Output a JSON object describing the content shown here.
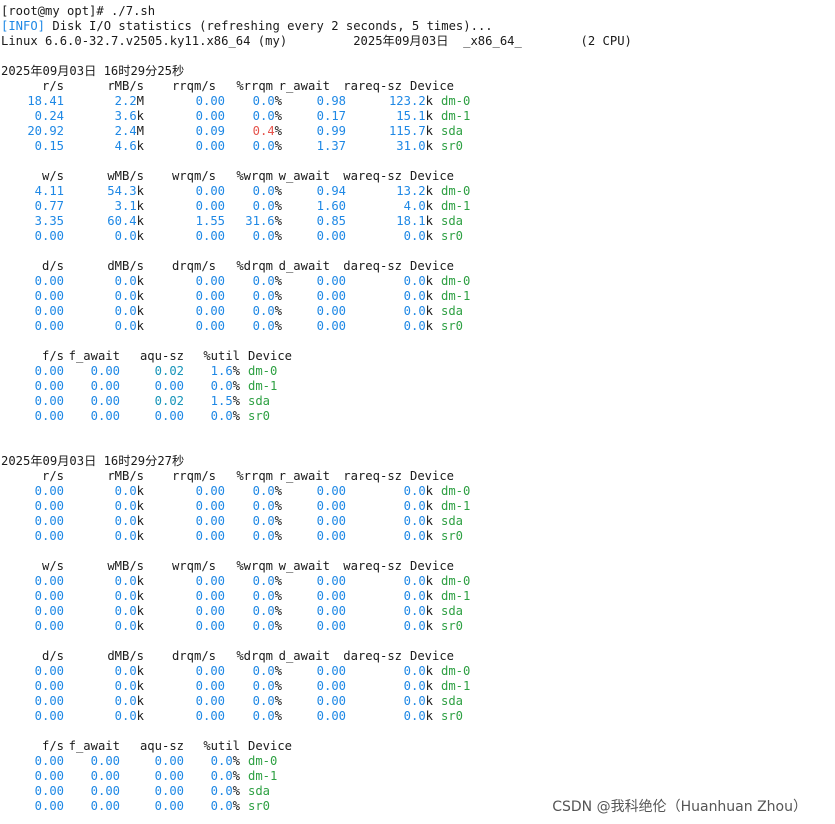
{
  "header": {
    "prompt": "[root@my opt]# ./7.sh",
    "info_tag": "[INFO]",
    "info_text": " Disk I/O statistics (refreshing every 2 seconds, 5 times)...",
    "system": "Linux 6.6.0-32.7.v2505.ky11.x86_64 (my)         2025年09月03日  _x86_64_        (2 CPU)"
  },
  "colors": {
    "value": "#1e88e5",
    "device": "#2ea043",
    "highlight": "#e5534b"
  },
  "snapshots": [
    {
      "timestamp": "2025年09月03日 16时29分25秒",
      "read": {
        "headers": [
          "r/s",
          "rMB/s",
          "rrqm/s",
          "%rrqm",
          "r_await",
          "rareq-sz",
          "Device"
        ],
        "rows": [
          [
            "18.41",
            "2.2",
            "M",
            "0.00",
            "0.0",
            "%",
            "0.98",
            "123.2",
            "k",
            "dm-0"
          ],
          [
            "0.24",
            "3.6",
            "k",
            "0.00",
            "0.0",
            "%",
            "0.17",
            "15.1",
            "k",
            "dm-1"
          ],
          [
            "20.92",
            "2.4",
            "M",
            "0.09",
            "0.4",
            "%",
            "0.99",
            "115.7",
            "k",
            "sda"
          ],
          [
            "0.15",
            "4.6",
            "k",
            "0.00",
            "0.0",
            "%",
            "1.37",
            "31.0",
            "k",
            "sr0"
          ]
        ]
      },
      "write": {
        "headers": [
          "w/s",
          "wMB/s",
          "wrqm/s",
          "%wrqm",
          "w_await",
          "wareq-sz",
          "Device"
        ],
        "rows": [
          [
            "4.11",
            "54.3",
            "k",
            "0.00",
            "0.0",
            "%",
            "0.94",
            "13.2",
            "k",
            "dm-0"
          ],
          [
            "0.77",
            "3.1",
            "k",
            "0.00",
            "0.0",
            "%",
            "1.60",
            "4.0",
            "k",
            "dm-1"
          ],
          [
            "3.35",
            "60.4",
            "k",
            "1.55",
            "31.6",
            "%",
            "0.85",
            "18.1",
            "k",
            "sda"
          ],
          [
            "0.00",
            "0.0",
            "k",
            "0.00",
            "0.0",
            "%",
            "0.00",
            "0.0",
            "k",
            "sr0"
          ]
        ]
      },
      "discard": {
        "headers": [
          "d/s",
          "dMB/s",
          "drqm/s",
          "%drqm",
          "d_await",
          "dareq-sz",
          "Device"
        ],
        "rows": [
          [
            "0.00",
            "0.0",
            "k",
            "0.00",
            "0.0",
            "%",
            "0.00",
            "0.0",
            "k",
            "dm-0"
          ],
          [
            "0.00",
            "0.0",
            "k",
            "0.00",
            "0.0",
            "%",
            "0.00",
            "0.0",
            "k",
            "dm-1"
          ],
          [
            "0.00",
            "0.0",
            "k",
            "0.00",
            "0.0",
            "%",
            "0.00",
            "0.0",
            "k",
            "sda"
          ],
          [
            "0.00",
            "0.0",
            "k",
            "0.00",
            "0.0",
            "%",
            "0.00",
            "0.0",
            "k",
            "sr0"
          ]
        ]
      },
      "flush": {
        "headers": [
          "f/s",
          "f_await",
          "aqu-sz",
          "%util",
          "Device"
        ],
        "rows": [
          [
            "0.00",
            "0.00",
            "0.02",
            "1.6",
            "%",
            "dm-0"
          ],
          [
            "0.00",
            "0.00",
            "0.00",
            "0.0",
            "%",
            "dm-1"
          ],
          [
            "0.00",
            "0.00",
            "0.02",
            "1.5",
            "%",
            "sda"
          ],
          [
            "0.00",
            "0.00",
            "0.00",
            "0.0",
            "%",
            "sr0"
          ]
        ]
      }
    },
    {
      "timestamp": "2025年09月03日 16时29分27秒",
      "read": {
        "headers": [
          "r/s",
          "rMB/s",
          "rrqm/s",
          "%rrqm",
          "r_await",
          "rareq-sz",
          "Device"
        ],
        "rows": [
          [
            "0.00",
            "0.0",
            "k",
            "0.00",
            "0.0",
            "%",
            "0.00",
            "0.0",
            "k",
            "dm-0"
          ],
          [
            "0.00",
            "0.0",
            "k",
            "0.00",
            "0.0",
            "%",
            "0.00",
            "0.0",
            "k",
            "dm-1"
          ],
          [
            "0.00",
            "0.0",
            "k",
            "0.00",
            "0.0",
            "%",
            "0.00",
            "0.0",
            "k",
            "sda"
          ],
          [
            "0.00",
            "0.0",
            "k",
            "0.00",
            "0.0",
            "%",
            "0.00",
            "0.0",
            "k",
            "sr0"
          ]
        ]
      },
      "write": {
        "headers": [
          "w/s",
          "wMB/s",
          "wrqm/s",
          "%wrqm",
          "w_await",
          "wareq-sz",
          "Device"
        ],
        "rows": [
          [
            "0.00",
            "0.0",
            "k",
            "0.00",
            "0.0",
            "%",
            "0.00",
            "0.0",
            "k",
            "dm-0"
          ],
          [
            "0.00",
            "0.0",
            "k",
            "0.00",
            "0.0",
            "%",
            "0.00",
            "0.0",
            "k",
            "dm-1"
          ],
          [
            "0.00",
            "0.0",
            "k",
            "0.00",
            "0.0",
            "%",
            "0.00",
            "0.0",
            "k",
            "sda"
          ],
          [
            "0.00",
            "0.0",
            "k",
            "0.00",
            "0.0",
            "%",
            "0.00",
            "0.0",
            "k",
            "sr0"
          ]
        ]
      },
      "discard": {
        "headers": [
          "d/s",
          "dMB/s",
          "drqm/s",
          "%drqm",
          "d_await",
          "dareq-sz",
          "Device"
        ],
        "rows": [
          [
            "0.00",
            "0.0",
            "k",
            "0.00",
            "0.0",
            "%",
            "0.00",
            "0.0",
            "k",
            "dm-0"
          ],
          [
            "0.00",
            "0.0",
            "k",
            "0.00",
            "0.0",
            "%",
            "0.00",
            "0.0",
            "k",
            "dm-1"
          ],
          [
            "0.00",
            "0.0",
            "k",
            "0.00",
            "0.0",
            "%",
            "0.00",
            "0.0",
            "k",
            "sda"
          ],
          [
            "0.00",
            "0.0",
            "k",
            "0.00",
            "0.0",
            "%",
            "0.00",
            "0.0",
            "k",
            "sr0"
          ]
        ]
      },
      "flush": {
        "headers": [
          "f/s",
          "f_await",
          "aqu-sz",
          "%util",
          "Device"
        ],
        "rows": [
          [
            "0.00",
            "0.00",
            "0.00",
            "0.0",
            "%",
            "dm-0"
          ],
          [
            "0.00",
            "0.00",
            "0.00",
            "0.0",
            "%",
            "dm-1"
          ],
          [
            "0.00",
            "0.00",
            "0.00",
            "0.0",
            "%",
            "sda"
          ],
          [
            "0.00",
            "0.00",
            "0.00",
            "0.0",
            "%",
            "sr0"
          ]
        ]
      }
    }
  ],
  "watermark": "CSDN @我科绝伦（Huanhuan Zhou）"
}
